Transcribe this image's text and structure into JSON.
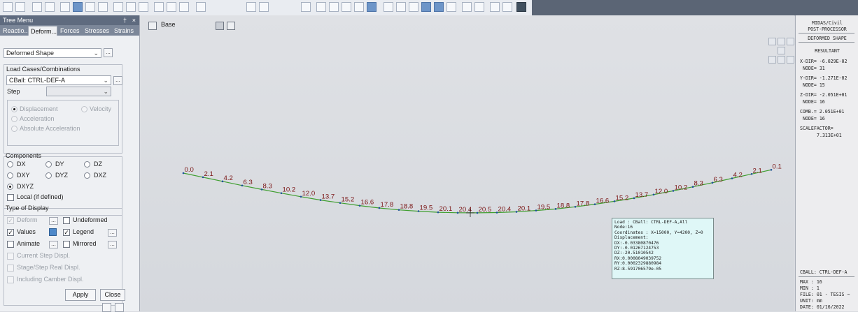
{
  "tree_menu": {
    "title": "Tree Menu",
    "pin": "†",
    "close": "×",
    "tabs": [
      "Reactio...",
      "Deform...",
      "Forces",
      "Stresses",
      "Strains"
    ],
    "active_tab": 1,
    "result_type": "Deformed Shape",
    "ellipsis": "...",
    "load_cases_label": "Load Cases/Combinations",
    "load_case": "CBall: CTRL-DEF-A",
    "step_label": "Step",
    "step_value": "",
    "motion": {
      "displacement": "Displacement",
      "velocity": "Velocity",
      "acceleration": "Acceleration",
      "absolute_acceleration": "Absolute Acceleration"
    },
    "components_label": "Components",
    "components": [
      "DX",
      "DY",
      "DZ",
      "DXY",
      "DYZ",
      "DXZ",
      "DXYZ"
    ],
    "selected_component": "DXYZ",
    "local_if_defined": "Local (if defined)",
    "type_of_display_label": "Type of Display",
    "display": {
      "deform": "Deform",
      "undeformed": "Undeformed",
      "values": "Values",
      "legend": "Legend",
      "animate": "Animate",
      "mirrored": "Mirrored",
      "current_step_displ": "Current Step Displ.",
      "stage_step_real_displ": "Stage/Step Real Displ.",
      "including_camber_displ": "Including Camber Displ."
    },
    "apply": "Apply",
    "close_button": "Close"
  },
  "viewport": {
    "view_label": "Base",
    "nodes": [
      {
        "label": "0.0",
        "value": 0.0
      },
      {
        "label": "2.1",
        "value": 2.1
      },
      {
        "label": "4.2",
        "value": 4.2
      },
      {
        "label": "6.3",
        "value": 6.3
      },
      {
        "label": "8.3",
        "value": 8.3
      },
      {
        "label": "10.2",
        "value": 10.2
      },
      {
        "label": "12.0",
        "value": 12.0
      },
      {
        "label": "13.7",
        "value": 13.7
      },
      {
        "label": "15.2",
        "value": 15.2
      },
      {
        "label": "16.6",
        "value": 16.6
      },
      {
        "label": "17.8",
        "value": 17.8
      },
      {
        "label": "18.8",
        "value": 18.8
      },
      {
        "label": "19.5",
        "value": 19.5
      },
      {
        "label": "20.1",
        "value": 20.1
      },
      {
        "label": "20.4",
        "value": 20.4
      },
      {
        "label": "20.5",
        "value": 20.5
      },
      {
        "label": "20.4",
        "value": 20.4
      },
      {
        "label": "20.1",
        "value": 20.1
      },
      {
        "label": "19.5",
        "value": 19.5
      },
      {
        "label": "18.8",
        "value": 18.8
      },
      {
        "label": "17.8",
        "value": 17.8
      },
      {
        "label": "16.6",
        "value": 16.6
      },
      {
        "label": "15.2",
        "value": 15.2
      },
      {
        "label": "13.7",
        "value": 13.7
      },
      {
        "label": "12.0",
        "value": 12.0
      },
      {
        "label": "10.2",
        "value": 10.2
      },
      {
        "label": "8.3",
        "value": 8.3
      },
      {
        "label": "6.3",
        "value": 6.3
      },
      {
        "label": "4.2",
        "value": 4.2
      },
      {
        "label": "2.1",
        "value": 2.1
      },
      {
        "label": "0.1",
        "value": 0.1
      }
    ],
    "deformed_line_color": "#3f9e2f",
    "value_label_color": "#7a1414",
    "tooltip": {
      "load": "Load : CBall: CTRL-DEF-A,All",
      "node": "Node:16",
      "coordinates": "Coordinates : X=15000, Y=4200, Z=0",
      "displacement": "Displacement:",
      "dx": "DX:-0.03380870476",
      "dy": "DY:-0.01267124753",
      "dz": "DZ:-20.51010542",
      "rx": "RX:0.0008049039752",
      "ry": "RY:0.0002329880984",
      "rz": "RZ:8.591706579e-05"
    }
  },
  "post_processor": {
    "line1": "MIDAS/Civil",
    "line2": "POST-PROCESSOR",
    "mode": "DEFORMED SHAPE",
    "resultant": "RESULTANT",
    "x_dir": "X-DIR= -6.029E-02",
    "x_node": "NODE= 31",
    "y_dir": "Y-DIR= -1.271E-02",
    "y_node": "NODE= 15",
    "z_dir": "Z-DIR= -2.051E+01",
    "z_node": "NODE= 16",
    "comb": "COMB.= 2.051E+01",
    "comb_node": "NODE= 16",
    "scale_label": "SCALEFACTOR=",
    "scale_value": "7.313E+01",
    "cball": "CBALL: CTRL-DEF-A",
    "max": "MAX : 16",
    "min": "MIN : 1",
    "file": "FILE: 01 - TESIS ~",
    "unit": "UNIT: mm",
    "date": "DATE: 01/16/2022"
  }
}
